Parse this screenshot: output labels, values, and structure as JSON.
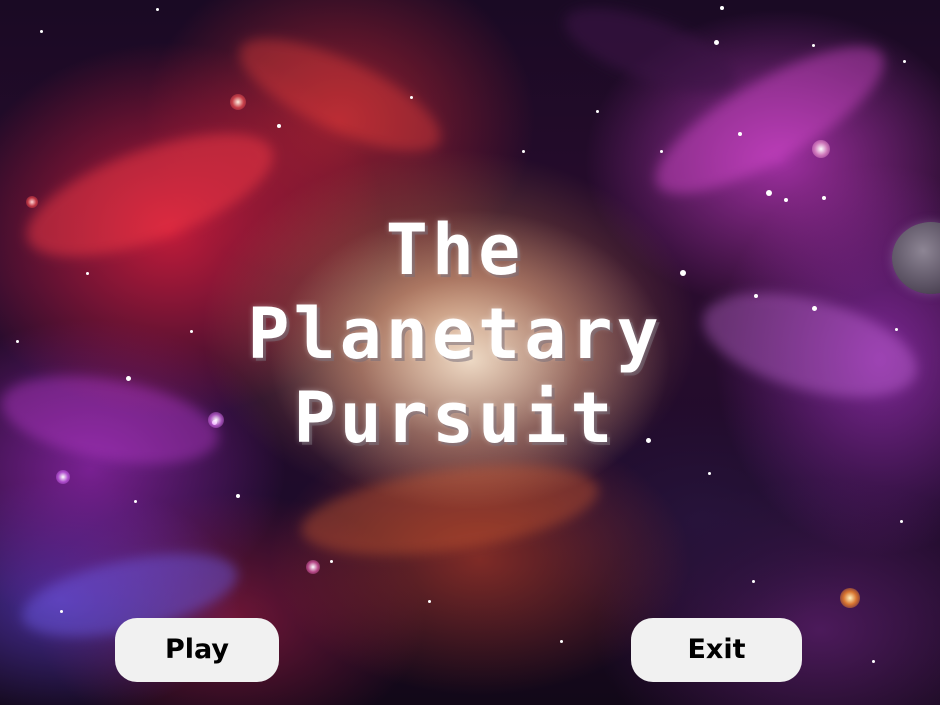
{
  "game": {
    "title_lines": [
      "The",
      "Planetary",
      "Pursuit"
    ]
  },
  "menu": {
    "play_label": "Play",
    "exit_label": "Exit"
  },
  "colors": {
    "button_background": "#f1f1f1",
    "button_text": "#000000",
    "title_text": "#ffffff"
  }
}
